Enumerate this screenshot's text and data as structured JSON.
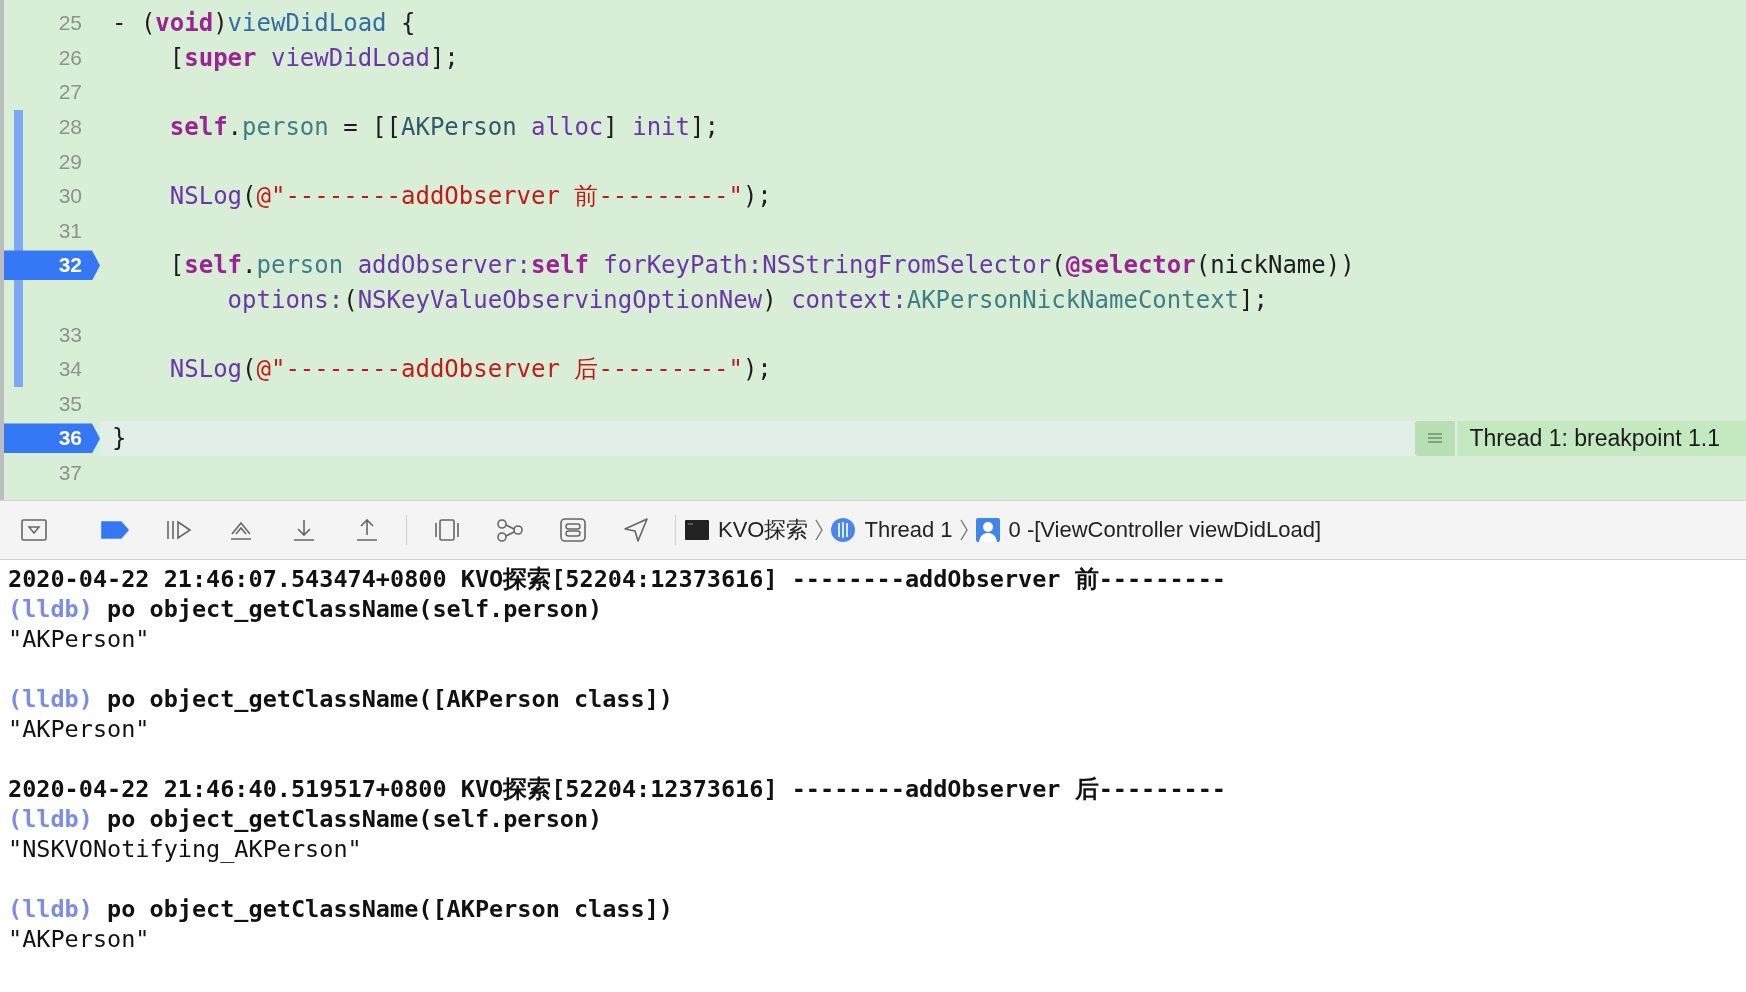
{
  "editor": {
    "lines": [
      {
        "number": "25",
        "kind": "signature",
        "breakpoint": false,
        "current": false,
        "changed": false,
        "tokens": [
          {
            "kind": "plain",
            "text": "- ("
          },
          {
            "kind": "keyword",
            "text": "void"
          },
          {
            "kind": "plain",
            "text": ")"
          },
          {
            "kind": "decl",
            "text": "viewDidLoad"
          },
          {
            "kind": "plain",
            "text": " {"
          }
        ]
      },
      {
        "number": "26",
        "kind": "body",
        "breakpoint": false,
        "current": false,
        "changed": false,
        "tokens": [
          {
            "kind": "plain",
            "text": "["
          },
          {
            "kind": "keyword",
            "text": "super"
          },
          {
            "kind": "method",
            "text": " viewDidLoad"
          },
          {
            "kind": "plain",
            "text": "];"
          }
        ]
      },
      {
        "number": "27",
        "breakpoint": false,
        "current": false,
        "changed": false
      },
      {
        "number": "28",
        "kind": "body",
        "breakpoint": false,
        "current": false,
        "changed": true,
        "tokens": [
          {
            "kind": "keyword",
            "text": "self"
          },
          {
            "kind": "plain",
            "text": "."
          },
          {
            "kind": "project",
            "text": "person"
          },
          {
            "kind": "plain",
            "text": " = [["
          },
          {
            "kind": "type",
            "text": "AKPerson"
          },
          {
            "kind": "method",
            "text": " alloc"
          },
          {
            "kind": "plain",
            "text": "] "
          },
          {
            "kind": "method",
            "text": "init"
          },
          {
            "kind": "plain",
            "text": "];"
          }
        ]
      },
      {
        "number": "29",
        "breakpoint": false,
        "current": false,
        "changed": true
      },
      {
        "number": "30",
        "kind": "body",
        "breakpoint": false,
        "current": false,
        "changed": true,
        "tokens": [
          {
            "kind": "method",
            "text": "NSLog"
          },
          {
            "kind": "plain",
            "text": "("
          },
          {
            "kind": "string",
            "text": "@\"--------addObserver 前---------\""
          },
          {
            "kind": "plain",
            "text": ");"
          }
        ]
      },
      {
        "number": "31",
        "breakpoint": false,
        "current": false,
        "changed": true
      },
      {
        "number": "32",
        "kind": "body",
        "breakpoint": true,
        "current": false,
        "changed": true,
        "tokens": [
          {
            "kind": "plain",
            "text": "["
          },
          {
            "kind": "keyword",
            "text": "self"
          },
          {
            "kind": "plain",
            "text": "."
          },
          {
            "kind": "project",
            "text": "person"
          },
          {
            "kind": "method",
            "text": " addObserver:"
          },
          {
            "kind": "keyword",
            "text": "self"
          },
          {
            "kind": "method",
            "text": " forKeyPath:NSStringFromSelector"
          },
          {
            "kind": "plain",
            "text": "("
          },
          {
            "kind": "keyword",
            "text": "@selector"
          },
          {
            "kind": "plain",
            "text": "(nickName))"
          }
        ],
        "continuation": [
          {
            "kind": "method",
            "text": "options:"
          },
          {
            "kind": "plain",
            "text": "("
          },
          {
            "kind": "method",
            "text": "NSKeyValueObservingOptionNew"
          },
          {
            "kind": "plain",
            "text": ") "
          },
          {
            "kind": "method",
            "text": "context:"
          },
          {
            "kind": "project",
            "text": "AKPersonNickNameContext"
          },
          {
            "kind": "plain",
            "text": "];"
          }
        ]
      },
      {
        "number": "33",
        "breakpoint": false,
        "current": false,
        "changed": true
      },
      {
        "number": "34",
        "kind": "body",
        "breakpoint": false,
        "current": false,
        "changed": true,
        "tokens": [
          {
            "kind": "method",
            "text": "NSLog"
          },
          {
            "kind": "plain",
            "text": "("
          },
          {
            "kind": "string",
            "text": "@\"--------addObserver 后---------\""
          },
          {
            "kind": "plain",
            "text": ");"
          }
        ]
      },
      {
        "number": "35",
        "breakpoint": false,
        "current": false,
        "changed": false
      },
      {
        "number": "36",
        "kind": "signature",
        "breakpoint": true,
        "current": true,
        "changed": false,
        "tokens": [
          {
            "kind": "plain",
            "text": "}"
          }
        ],
        "annotation": "Thread 1: breakpoint 1.1"
      },
      {
        "number": "37",
        "breakpoint": false,
        "current": false,
        "changed": false
      }
    ]
  },
  "toolbar": {
    "breakpoints_active": true,
    "breadcrumb": [
      {
        "kind": "app",
        "label": "KVO探索"
      },
      {
        "kind": "thread",
        "label": "Thread 1"
      },
      {
        "kind": "frame",
        "label": "0 -[ViewController viewDidLoad]"
      }
    ]
  },
  "console": {
    "lines": [
      {
        "kind": "log",
        "text": "2020-04-22 21:46:07.543474+0800 KVO探索[52204:12373616] --------addObserver 前---------"
      },
      {
        "kind": "prompt",
        "prompt": "(lldb)",
        "text": "po object_getClassName(self.person)"
      },
      {
        "kind": "output",
        "text": "\"AKPerson\""
      },
      {
        "kind": "blank"
      },
      {
        "kind": "prompt",
        "prompt": "(lldb)",
        "text": "po object_getClassName([AKPerson class])"
      },
      {
        "kind": "output",
        "text": "\"AKPerson\""
      },
      {
        "kind": "blank"
      },
      {
        "kind": "log",
        "text": "2020-04-22 21:46:40.519517+0800 KVO探索[52204:12373616] --------addObserver 后---------"
      },
      {
        "kind": "prompt",
        "prompt": "(lldb)",
        "text": "po object_getClassName(self.person)"
      },
      {
        "kind": "output",
        "text": "\"NSKVONotifying_AKPerson\""
      },
      {
        "kind": "blank"
      },
      {
        "kind": "prompt",
        "prompt": "(lldb)",
        "text": "po object_getClassName([AKPerson class])"
      },
      {
        "kind": "output",
        "text": "\"AKPerson\""
      }
    ]
  }
}
